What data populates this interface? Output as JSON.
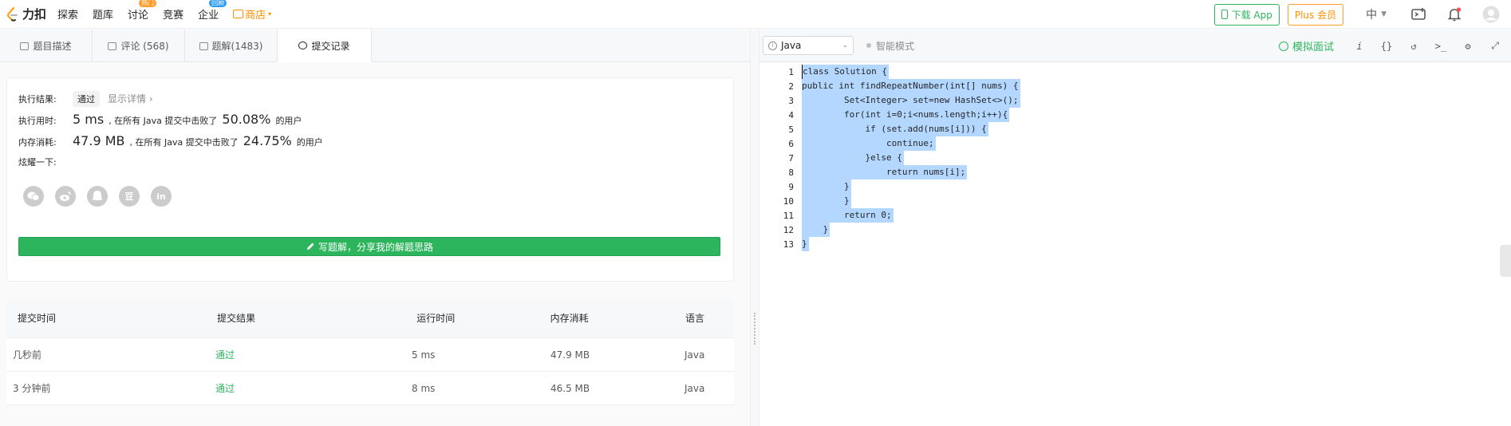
{
  "topnav": {
    "logo": "力扣",
    "items": [
      {
        "label": "探索",
        "badge": ""
      },
      {
        "label": "题库",
        "badge": ""
      },
      {
        "label": "讨论",
        "badge": "热门"
      },
      {
        "label": "竞赛",
        "badge": ""
      },
      {
        "label": "企业",
        "badge": "回顾"
      }
    ],
    "shop": "商店",
    "download_app": "下载 App",
    "plus": "Plus 会员",
    "lang": "中"
  },
  "tabs": [
    {
      "label": "题目描述"
    },
    {
      "label": "评论 (568)"
    },
    {
      "label": "题解(1483)"
    },
    {
      "label": "提交记录"
    }
  ],
  "result": {
    "exec_label": "执行结果:",
    "status": "通过",
    "detail": "显示详情 ›",
    "time_label": "执行用时:",
    "time_value": "5 ms",
    "time_mid": ", 在所有 Java 提交中击败了",
    "time_pct": "50.08%",
    "time_suffix": "的用户",
    "mem_label": "内存消耗:",
    "mem_value": "47.9 MB",
    "mem_mid": ", 在所有 Java 提交中击败了",
    "mem_pct": "24.75%",
    "mem_suffix": "的用户",
    "share_label": "炫耀一下:",
    "share_icons": [
      "wechat-icon",
      "weibo-icon",
      "qq-icon",
      "douban-icon",
      "linkedin-icon"
    ],
    "share_glyphs": [
      "",
      "",
      "",
      "豆",
      "in"
    ],
    "write_btn": "写题解，分享我的解题思路"
  },
  "table": {
    "headers": [
      "提交时间",
      "提交结果",
      "运行时间",
      "内存消耗",
      "语言"
    ],
    "rows": [
      [
        "几秒前",
        "通过",
        "5 ms",
        "47.9 MB",
        "Java"
      ],
      [
        "3 分钟前",
        "通过",
        "8 ms",
        "46.5 MB",
        "Java"
      ]
    ]
  },
  "editor": {
    "language": "Java",
    "smart_mode": "智能模式",
    "mock_interview": "模拟面试",
    "tools": [
      "i",
      "{}",
      "↺",
      ">_",
      "⚙",
      "⤢"
    ],
    "code": [
      "class Solution {",
      "public int findRepeatNumber(int[] nums) {",
      "        Set<Integer> set=new HashSet<>();",
      "        for(int i=0;i<nums.length;i++){",
      "            if (set.add(nums[i])) {",
      "                continue;",
      "            }else {",
      "                return nums[i];",
      "        }",
      "        }",
      "        return 0;",
      "    }",
      "}"
    ]
  },
  "colors": {
    "accent_green": "#2db55d",
    "orange": "#ff8f00",
    "selection": "#b3d7ff"
  }
}
